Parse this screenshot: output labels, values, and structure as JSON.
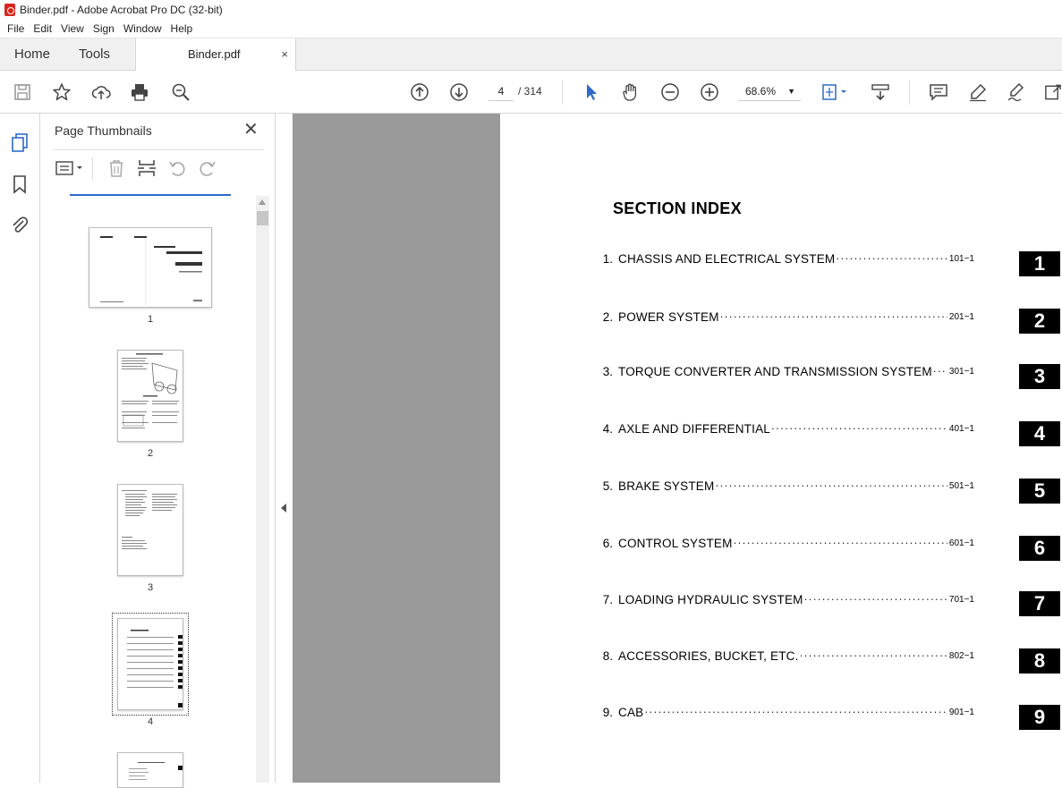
{
  "window": {
    "title": "Binder.pdf - Adobe Acrobat Pro DC (32-bit)"
  },
  "menu": [
    "File",
    "Edit",
    "View",
    "Sign",
    "Window",
    "Help"
  ],
  "tabs": {
    "home": "Home",
    "tools": "Tools",
    "document": "Binder.pdf",
    "close": "×"
  },
  "toolbar": {
    "current_page": "4",
    "total_pages": "/ 314",
    "zoom": "68.6%",
    "icons": [
      "save-icon",
      "star-icon",
      "cloud-upload-icon",
      "print-icon",
      "search-zoom-icon",
      "prev-page-icon",
      "next-page-icon",
      "select-arrow-icon",
      "hand-icon",
      "zoom-out-icon",
      "zoom-in-icon",
      "fit-page-icon",
      "scroll-mode-icon",
      "comment-icon",
      "highlight-icon",
      "sign-icon",
      "share-icon"
    ]
  },
  "panel": {
    "title": "Page Thumbnails",
    "close": "✕",
    "thumbnails": [
      {
        "label": "1"
      },
      {
        "label": "2"
      },
      {
        "label": "3"
      },
      {
        "label": "4",
        "selected": true
      }
    ]
  },
  "page": {
    "heading": "SECTION INDEX",
    "entries": [
      {
        "num": "1.",
        "label": "CHASSIS AND ELECTRICAL SYSTEM",
        "page": "101−1",
        "tab": "1"
      },
      {
        "num": "2.",
        "label": "POWER SYSTEM",
        "page": "201−1",
        "tab": "2"
      },
      {
        "num": "3.",
        "label": "TORQUE CONVERTER AND TRANSMISSION SYSTEM",
        "page": "301−1",
        "tab": "3"
      },
      {
        "num": "4.",
        "label": "AXLE AND DIFFERENTIAL",
        "page": "401−1",
        "tab": "4"
      },
      {
        "num": "5.",
        "label": "BRAKE SYSTEM",
        "page": "501−1",
        "tab": "5"
      },
      {
        "num": "6.",
        "label": "CONTROL SYSTEM",
        "page": "601−1",
        "tab": "6"
      },
      {
        "num": "7.",
        "label": "LOADING HYDRAULIC SYSTEM",
        "page": "701−1",
        "tab": "7"
      },
      {
        "num": "8.",
        "label": "ACCESSORIES, BUCKET, ETC.",
        "page": "802−1",
        "tab": "8"
      },
      {
        "num": "9.",
        "label": "CAB",
        "page": "901−1",
        "tab": "9"
      }
    ]
  }
}
